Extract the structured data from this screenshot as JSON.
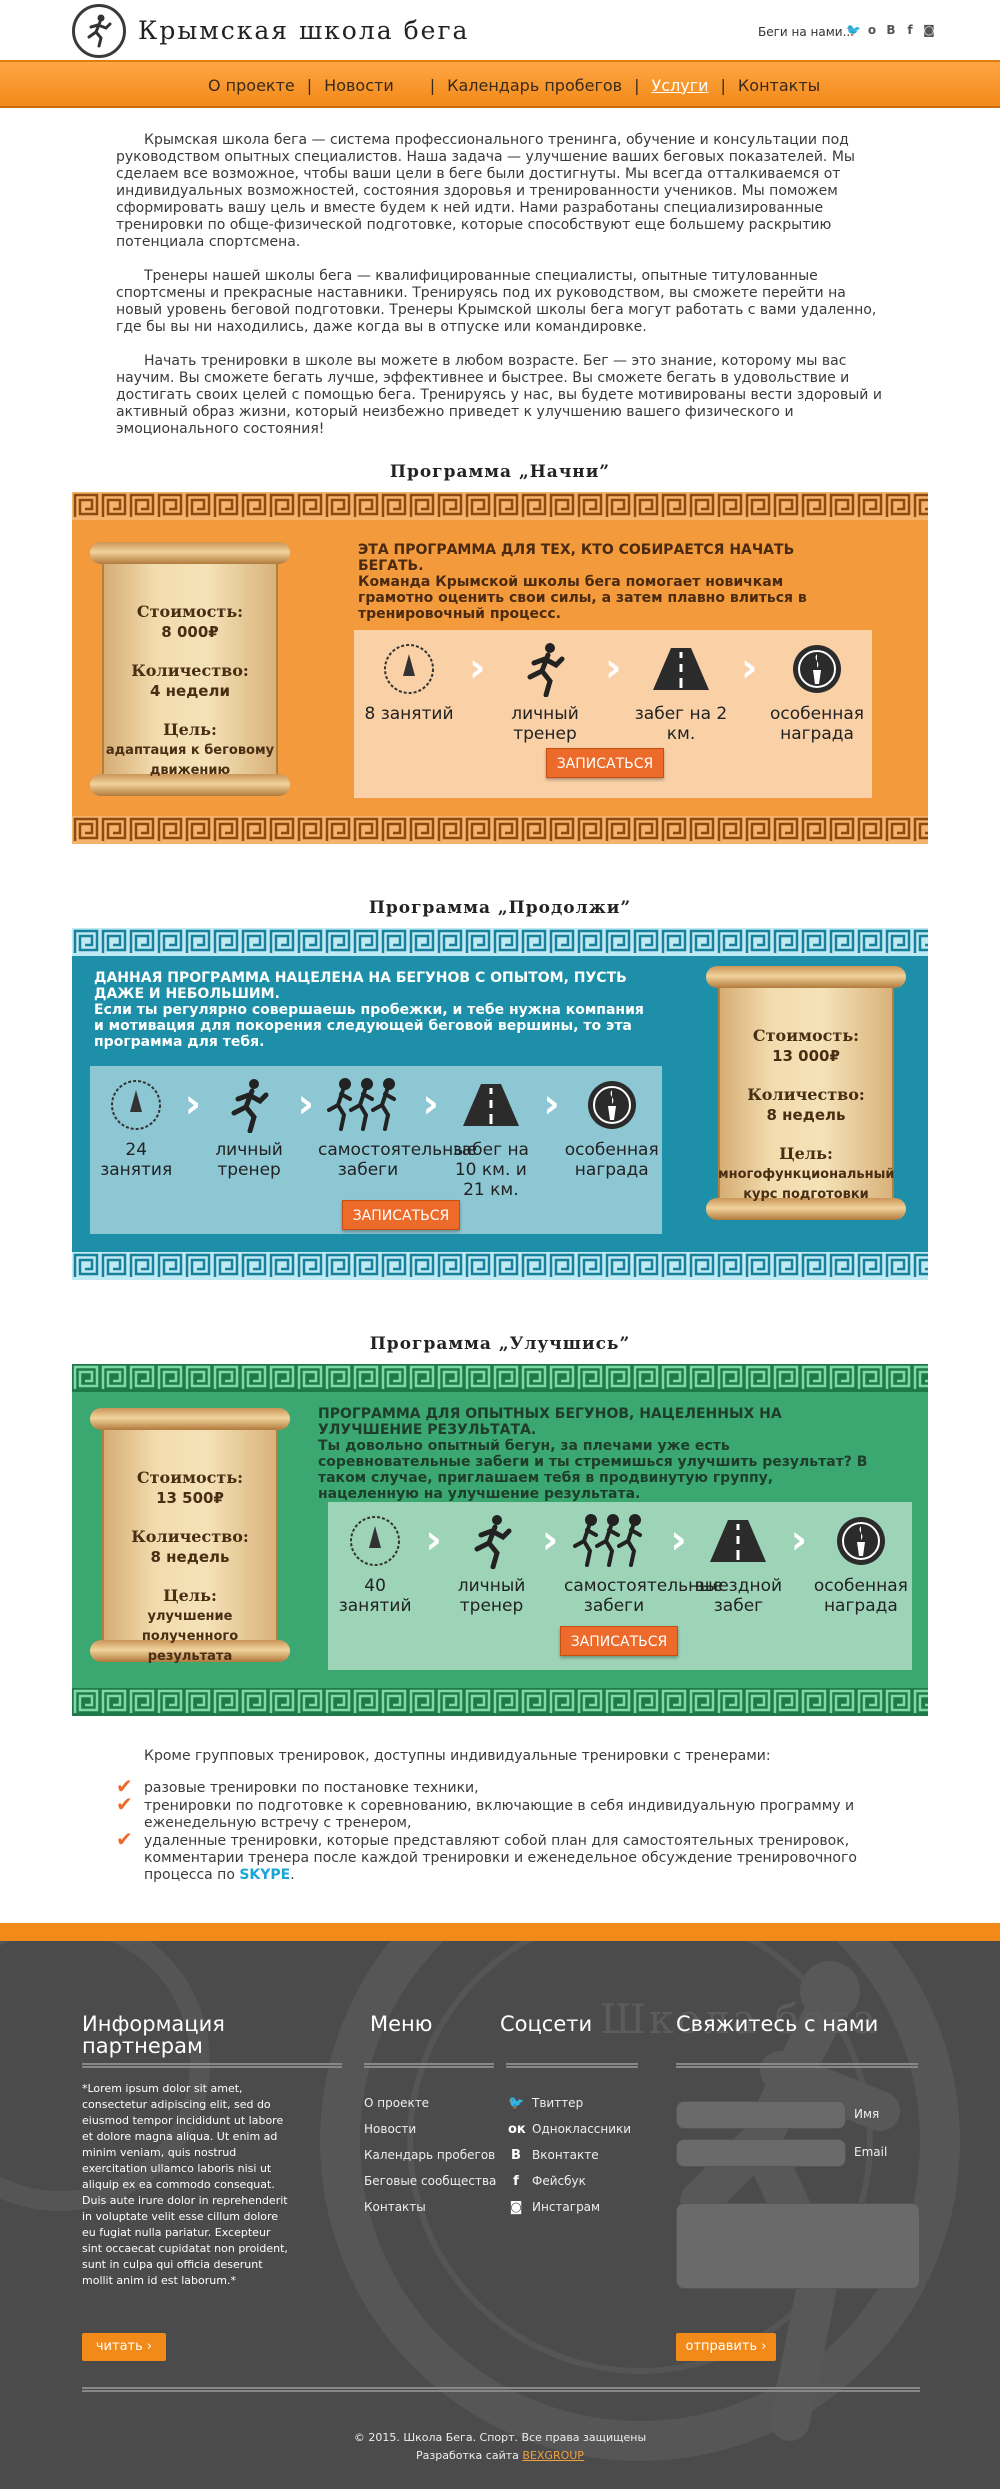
{
  "header": {
    "logo_title": "Крымская школа бега",
    "run_on_label": "Беги на нами...",
    "social_icons": [
      "twitter-icon",
      "odnoklassniki-icon",
      "vkontakte-icon",
      "facebook-icon",
      "instagram-icon"
    ]
  },
  "nav": {
    "items": [
      {
        "label": "О проекте"
      },
      {
        "label": "Новости"
      },
      {
        "label": "Календарь пробегов"
      },
      {
        "label": "Услуги",
        "active": true
      },
      {
        "label": "Контакты"
      }
    ]
  },
  "intro": {
    "p1": "Крымская школа бега — система профессионального тренинга, обучение и консультации под руководством опытных специалистов. Наша задача — улучшение ваших беговых показателей. Мы сделаем все возможное, чтобы ваши цели в беге были достигнуты. Мы всегда отталкиваемся от индивидуальных возможностей, состояния здоровья и тренированности учеников. Мы поможем сформировать вашу цель и вместе будем к ней идти. Нами разработаны специализированные тренировки по обще-физической подготовке, которые способствуют еще большему раскрытию потенциала спортсмена.",
    "p2": "Тренеры  нашей школы бега — квалифицированные специалисты, опытные титулованные спортсмены и прекрасные наставники. Тренируясь под их руководством, вы сможете перейти на новый уровень беговой подготовки. Тренеры Крымской школы бега могут работать с вами удаленно, где бы вы ни находились, даже когда вы в отпуске или командировке.",
    "p3": "Начать тренировки в  школе вы можете в любом возрасте. Бег — это знание, которому мы вас научим. Вы сможете бегать лучше, эффективнее и быстрее. Вы сможете бегать в удовольствие и достигать своих целей с помощью бега. Тренируясь у нас, вы будете мотивированы вести здоровый и активный образ жизни, который неизбежно приведет к улучшению вашего физического и эмоционального состояния!"
  },
  "programs": [
    {
      "title": "Программа „Начни”",
      "color": "#f39a3c",
      "cost_label": "Стоимость:",
      "cost": "8 000₽",
      "qty_label": "Количество:",
      "qty": "4 недели",
      "goal_label": "Цель:",
      "goal": "адаптация к беговому движению",
      "desc_head": "ЭТА ПРОГРАММА ДЛЯ ТЕХ, КТО СОБИРАЕТСЯ НАЧАТЬ БЕГАТЬ.",
      "desc_body": "Команда Крымской школы бега помогает новичкам грамотно оценить свои силы, а затем плавно влиться в тренировочный процесс.",
      "steps": [
        "8 занятий",
        "личный тренер",
        "забег на 2 км.",
        "особенная награда"
      ],
      "cta": "ЗАПИСАТЬСЯ"
    },
    {
      "title": "Программа „Продолжи”",
      "color": "#1d8fa8",
      "cost_label": "Стоимость:",
      "cost": "13 000₽",
      "qty_label": "Количество:",
      "qty": "8 недель",
      "goal_label": "Цель:",
      "goal": "многофункциональный курс подготовки",
      "desc_head": "ДАННАЯ ПРОГРАММА НАЦЕЛЕНА НА БЕГУНОВ С ОПЫТОМ, ПУСТЬ ДАЖЕ И НЕБОЛЬШИМ.",
      "desc_body": "Если ты регулярно совершаешь пробежки, и тебе нужна компания и мотивация для покорения следующей беговой вершины, то эта программа для тебя.",
      "steps": [
        "24 занятия",
        "личный тренер",
        "самостоятельные забеги",
        "забег на 10 км. и 21 км.",
        "особенная награда"
      ],
      "cta": "ЗАПИСАТЬСЯ"
    },
    {
      "title": "Программа „Улучшись”",
      "color": "#3aa870",
      "cost_label": "Стоимость:",
      "cost": "13 500₽",
      "qty_label": "Количество:",
      "qty": "8 недель",
      "goal_label": "Цель:",
      "goal": "улучшение полученного результата",
      "desc_head": "ПРОГРАММА ДЛЯ ОПЫТНЫХ БЕГУНОВ, НАЦЕЛЕННЫХ НА УЛУЧШЕНИЕ РЕЗУЛЬТАТА.",
      "desc_body": "Ты довольно опытный бегун, за плечами уже есть соревновательные забеги и ты стремишься улучшить результат? В таком случае, приглашаем тебя в продвинутую группу, нацеленную на улучшение результата.",
      "steps": [
        "40 занятий",
        "личный тренер",
        "самостоятельные забеги",
        "выездной забег",
        "особенная награда"
      ],
      "cta": "ЗАПИСАТЬСЯ"
    }
  ],
  "extra": {
    "lead": "Кроме групповых тренировок, доступны индивидуальные тренировки с тренерами:",
    "items": [
      "разовые тренировки по постановке техники,",
      "тренировки по подготовке к соревнованию, включающие в себя индивидуальную программу и еженедельную встречу с тренером,",
      "удаленные тренировки, которые представляют собой план для самостоятельных тренировок, комментарии тренера после каждой тренировки и еженедельное обсуждение тренировочного процесса по "
    ],
    "skype": "SKYPE",
    "skype_tail": "."
  },
  "footer": {
    "partners_title": "Информация партнерам",
    "lorem": "*Lorem ipsum dolor sit amet, consectetur adipiscing elit, sed do eiusmod tempor incididunt ut labore et dolore magna aliqua. Ut enim ad minim veniam, quis nostrud exercitation ullamco laboris nisi ut aliquip ex ea commodo consequat. Duis aute irure dolor in reprehenderit in voluptate velit esse cillum dolore eu fugiat nulla pariatur. Excepteur sint occaecat cupidatat non proident, sunt in culpa qui officia deserunt mollit anim id est laborum.*",
    "read_btn": "читать ›",
    "menu_title": "Меню",
    "menu_items": [
      "О проекте",
      "Новости",
      "Календарь пробегов",
      "Беговые сообщества",
      "Контакты"
    ],
    "social_title": "Соцсети",
    "social_items": [
      {
        "label": "Твиттер",
        "icon": "twitter-icon",
        "glyph": "🐦"
      },
      {
        "label": "Одноклассники",
        "icon": "odnoklassniki-icon",
        "glyph": "ок"
      },
      {
        "label": "Вконтакте",
        "icon": "vkontakte-icon",
        "glyph": "В"
      },
      {
        "label": "Фейсбук",
        "icon": "facebook-icon",
        "glyph": "f"
      },
      {
        "label": "Инстаграм",
        "icon": "instagram-icon",
        "glyph": "◙"
      }
    ],
    "contact_title": "Свяжитесь с нами",
    "name_label": "Имя",
    "email_label": "Email",
    "send_btn": "отправить ›",
    "copyright": "© 2015. Школа Бега. Спорт.  Все права защищены",
    "dev_prefix": "Разработка сайта ",
    "dev_link": "BEXGROUP",
    "watermark": "Школа бега"
  }
}
